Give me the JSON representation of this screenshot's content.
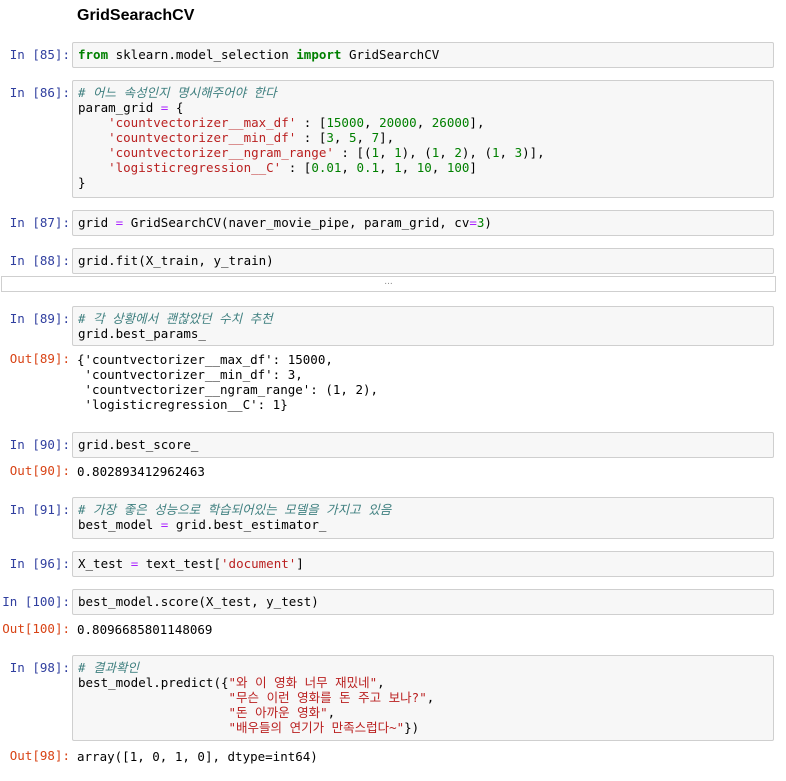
{
  "heading": "GridSearachCV",
  "collapsed_output": "...",
  "cells": {
    "c85": {
      "prompt": "In [85]:",
      "t1": "from",
      "t2": " sklearn.model_selection ",
      "t3": "import",
      "t4": " GridSearchCV"
    },
    "c86": {
      "prompt": "In [86]:",
      "comment": "# 어느 속성인지 명시해주어야 한다",
      "l2a": "param_grid ",
      "l2b": "=",
      "l2c": " {",
      "l3a": "    ",
      "l3b": "'countvectorizer__max_df'",
      "l3c": " : [",
      "l3d": "15000",
      "l3e": ", ",
      "l3f": "20000",
      "l3g": ", ",
      "l3h": "26000",
      "l3i": "],",
      "l4a": "    ",
      "l4b": "'countvectorizer__min_df'",
      "l4c": " : [",
      "l4d": "3",
      "l4e": ", ",
      "l4f": "5",
      "l4g": ", ",
      "l4h": "7",
      "l4i": "],",
      "l5a": "    ",
      "l5b": "'countvectorizer__ngram_range'",
      "l5c": " : [(",
      "l5d": "1",
      "l5e": ", ",
      "l5f": "1",
      "l5g": "), (",
      "l5h": "1",
      "l5i": ", ",
      "l5j": "2",
      "l5k": "), (",
      "l5l": "1",
      "l5m": ", ",
      "l5n": "3",
      "l5o": ")],",
      "l6a": "    ",
      "l6b": "'logisticregression__C'",
      "l6c": " : [",
      "l6d": "0.01",
      "l6e": ", ",
      "l6f": "0.1",
      "l6g": ", ",
      "l6h": "1",
      "l6i": ", ",
      "l6j": "10",
      "l6k": ", ",
      "l6l": "100",
      "l6m": "]",
      "l7": "}"
    },
    "c87": {
      "prompt": "In [87]:",
      "a": "grid ",
      "b": "=",
      "c": " GridSearchCV(naver_movie_pipe, param_grid, cv",
      "d": "=",
      "e": "3",
      "f": ")"
    },
    "c88": {
      "prompt": "In [88]:",
      "code": "grid.fit(X_train, y_train)"
    },
    "c89": {
      "prompt": "In [89]:",
      "comment": "# 각 상황에서 괜찮았던 수치 추천",
      "code": "grid.best_params_",
      "out_prompt": "Out[89]:",
      "out": [
        "{'countvectorizer__max_df': 15000,",
        " 'countvectorizer__min_df': 3,",
        " 'countvectorizer__ngram_range': (1, 2),",
        " 'logisticregression__C': 1}"
      ]
    },
    "c90": {
      "prompt": "In [90]:",
      "code": "grid.best_score_",
      "out_prompt": "Out[90]:",
      "out": "0.802893412962463"
    },
    "c91": {
      "prompt": "In [91]:",
      "comment": "# 가장 좋은 성능으로 학습되어있는 모델을 가지고 있음",
      "a": "best_model ",
      "b": "=",
      "c": " grid.best_estimator_"
    },
    "c96": {
      "prompt": "In [96]:",
      "a": "X_test ",
      "b": "=",
      "c": " text_test[",
      "d": "'document'",
      "e": "]"
    },
    "c100": {
      "prompt": "In [100]:",
      "code": "best_model.score(X_test, y_test)",
      "out_prompt": "Out[100]:",
      "out": "0.8096685801148069"
    },
    "c98": {
      "prompt": "In [98]:",
      "comment": "# 결과확인",
      "l2a": "best_model.predict({",
      "l2b": "\"와 이 영화 너무 재밌네\"",
      "l2c": ",",
      "l3a": "                    ",
      "l3b": "\"무슨 이런 영화를 돈 주고 보나?\"",
      "l3c": ",",
      "l4a": "                    ",
      "l4b": "\"돈 아까운 영화\"",
      "l4c": ",",
      "l5a": "                    ",
      "l5b": "\"배우들의 연기가 만족스럽다~\"",
      "l5c": "})",
      "out_prompt": "Out[98]:",
      "out_a": "array([",
      "out_b": "1, 0, 1, 0",
      "out_c": "], dtype=int64)"
    }
  }
}
